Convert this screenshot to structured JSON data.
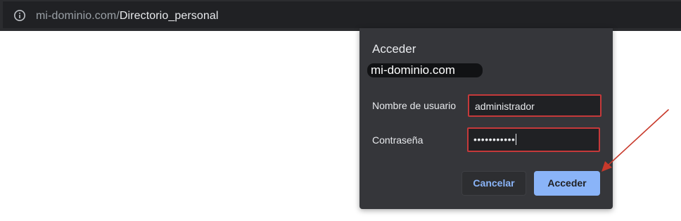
{
  "browser": {
    "url_domain": "mi-dominio.com/",
    "url_path": "Directorio_personal",
    "info_icon": "info-circle-icon"
  },
  "dialog": {
    "title": "Acceder",
    "origin": "mi-dominio.com",
    "username_label": "Nombre de usuario",
    "username_value": "administrador",
    "password_label": "Contraseña",
    "password_masked": "•••••••••••",
    "cancel_label": "Cancelar",
    "accept_label": "Acceder"
  },
  "colors": {
    "dialog_bg": "#35363a",
    "field_border_highlight": "#c5393a",
    "accent": "#8ab4f8",
    "annotation_arrow": "#c8392b"
  }
}
